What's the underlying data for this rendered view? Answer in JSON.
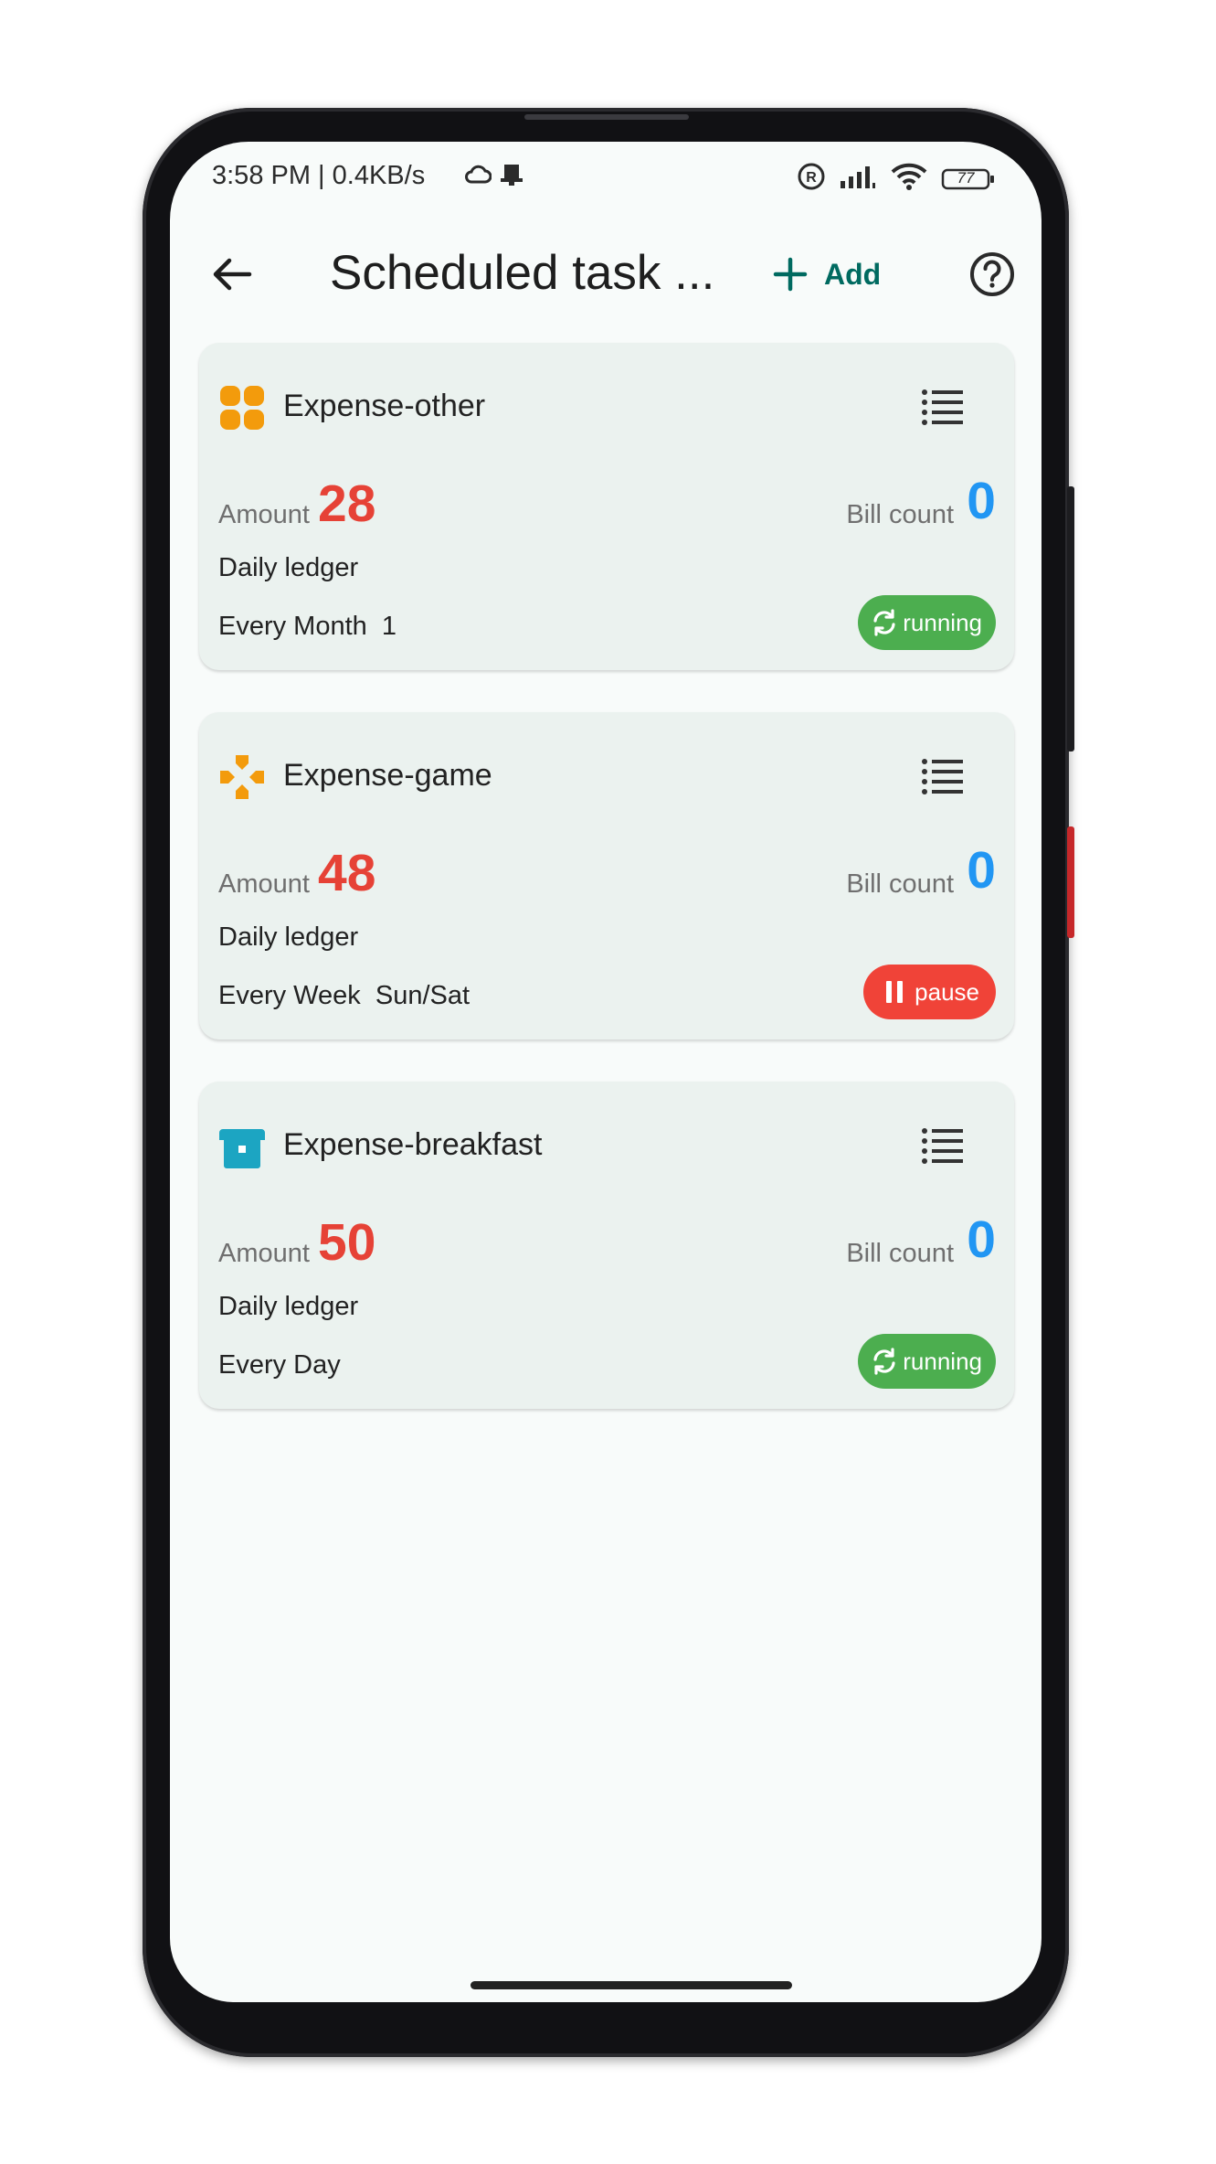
{
  "status_bar": {
    "time": "3:58 PM | 0.4KB/s",
    "battery": "77"
  },
  "app_bar": {
    "title": "Scheduled task ...",
    "add_label": "Add"
  },
  "colors": {
    "accent": "#006a60",
    "amount": "#e64236",
    "bill_count": "#2196f3",
    "running": "#4cae4f",
    "pause": "#f04338",
    "card_bg": "#ebf2ef"
  },
  "tasks": [
    {
      "category": "Expense-other",
      "icon": "apps-grid-icon",
      "icon_color": "#f39b0c",
      "amount_label": "Amount",
      "amount": "28",
      "bill_count_label": "Bill count",
      "bill_count": "0",
      "ledger": "Daily ledger",
      "schedule": "Every Month  1",
      "status": "running"
    },
    {
      "category": "Expense-game",
      "icon": "gamepad-icon",
      "icon_color": "#f39b0c",
      "amount_label": "Amount",
      "amount": "48",
      "bill_count_label": "Bill count",
      "bill_count": "0",
      "ledger": "Daily ledger",
      "schedule": "Every Week  Sun/Sat",
      "status": "pause"
    },
    {
      "category": "Expense-breakfast",
      "icon": "bread-icon",
      "icon_color": "#1ca5c2",
      "amount_label": "Amount",
      "amount": "50",
      "bill_count_label": "Bill count",
      "bill_count": "0",
      "ledger": "Daily ledger",
      "schedule": "Every Day",
      "status": "running"
    }
  ]
}
